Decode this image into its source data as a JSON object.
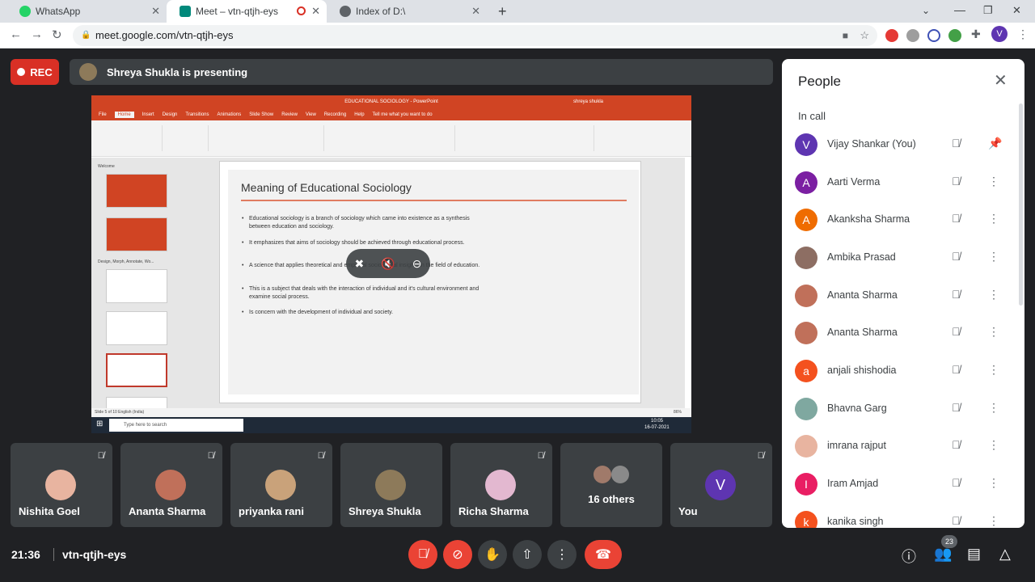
{
  "browser": {
    "tabs": [
      {
        "title": "WhatsApp",
        "favicon_color": "#25d366"
      },
      {
        "title": "Meet – vtn-qtjh-eys",
        "favicon_color": "#00897b"
      },
      {
        "title": "Index of D:\\",
        "favicon_color": "#5f6368"
      }
    ],
    "url": "meet.google.com/vtn-qtjh-eys",
    "profile_initial": "V"
  },
  "meet": {
    "rec_label": "REC",
    "presenting_text": "Shreya Shukla is presenting",
    "meeting_time": "21:36",
    "meeting_code": "vtn-qtjh-eys",
    "participant_count": "23"
  },
  "powerpoint": {
    "window_title": "EDUCATIONAL SOCIOLOGY - PowerPoint",
    "user": "shreya shukla",
    "tabs": [
      "File",
      "Home",
      "Insert",
      "Design",
      "Transitions",
      "Animations",
      "Slide Show",
      "Review",
      "View",
      "Recording",
      "Help",
      "Tell me what you want to do"
    ],
    "slide_title": "Meaning of Educational Sociology",
    "bullets": [
      "Educational sociology is a branch of sociology which came into existence as a synthesis between education and sociology.",
      "It emphasizes that aims of sociology should be achieved through educational process.",
      "A science that applies theoretical and empirical sociological insights in the field of education.",
      "This is a subject that deals with the interaction of individual and it's cultural environment and examine social process.",
      "Is concern with the development of individual and society."
    ],
    "section_welcome": "Welcome",
    "section_design": "Design, Morph, Annotate, Wo...",
    "status_text": "Slide 5 of 10    English (India)",
    "zoom": "86%",
    "taskbar_search": "Type here to search",
    "taskbar_time": "10:05",
    "taskbar_date": "16-07-2021"
  },
  "tiles": [
    {
      "name": "Nishita Goel",
      "avatar_color": "#e8b4a0"
    },
    {
      "name": "Ananta Sharma",
      "avatar_color": "#c0705a"
    },
    {
      "name": "priyanka rani",
      "avatar_color": "#c9a27a"
    },
    {
      "name": "Shreya Shukla",
      "avatar_color": "#8d7a5a"
    },
    {
      "name": "Richa Sharma",
      "avatar_color": "#e3b8d0"
    },
    {
      "name": "16 others",
      "avatar_color": "#a07a6a"
    },
    {
      "name": "You",
      "avatar_initial": "V",
      "avatar_color": "#5e35b1"
    }
  ],
  "people_panel": {
    "title": "People",
    "section": "In call",
    "participants": [
      {
        "name": "Vijay Shankar (You)",
        "initial": "V",
        "color": "#5e35b1",
        "pinned": true
      },
      {
        "name": "Aarti Verma",
        "initial": "A",
        "color": "#7b1fa2"
      },
      {
        "name": "Akanksha Sharma",
        "initial": "A",
        "color": "#ef6c00"
      },
      {
        "name": "Ambika Prasad",
        "initial": "",
        "color": "#8d6e63"
      },
      {
        "name": "Ananta Sharma",
        "initial": "",
        "color": "#c0705a"
      },
      {
        "name": "Ananta Sharma",
        "initial": "",
        "color": "#c0705a"
      },
      {
        "name": "anjali shishodia",
        "initial": "a",
        "color": "#f4511e"
      },
      {
        "name": "Bhavna Garg",
        "initial": "",
        "color": "#7fa8a0"
      },
      {
        "name": "imrana rajput",
        "initial": "",
        "color": "#e8b4a0"
      },
      {
        "name": "Iram Amjad",
        "initial": "I",
        "color": "#e91e63"
      },
      {
        "name": "kanika singh",
        "initial": "k",
        "color": "#f4511e"
      }
    ]
  }
}
